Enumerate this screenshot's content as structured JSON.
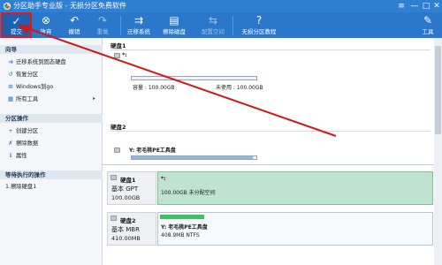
{
  "window": {
    "title": "分区助手专业版 - 无损分区免费软件",
    "controls": {
      "menu": "≡",
      "minimize": "—",
      "maximize": "□",
      "close": "✕"
    }
  },
  "toolbar": {
    "buttons": [
      {
        "label": "提交",
        "icon": "check-icon",
        "glyph": "✓"
      },
      {
        "label": "放弃",
        "icon": "cancel-icon",
        "glyph": "⊗"
      },
      {
        "label": "撤销",
        "icon": "undo-icon",
        "glyph": "↶"
      },
      {
        "label": "重做",
        "icon": "redo-icon",
        "glyph": "↷"
      },
      {
        "label": "迁移系统",
        "icon": "migrate-os-icon",
        "glyph": "⇉"
      },
      {
        "label": "擦除磁盘",
        "icon": "wipe-disk-icon",
        "glyph": "▤"
      },
      {
        "label": "配置空间",
        "icon": "allocate-space-icon",
        "glyph": "⇆"
      },
      {
        "label": "无损分区教程",
        "icon": "tutorial-icon",
        "glyph": "?"
      },
      {
        "label": "工具",
        "icon": "tools-icon",
        "glyph": "✎"
      }
    ]
  },
  "left_panel": {
    "sections": [
      {
        "title": "向导",
        "items": [
          {
            "label": "迁移系统到固态硬盘",
            "icon": "ssd-migrate-icon",
            "glyph": "⇉"
          },
          {
            "label": "恢复分区",
            "icon": "recover-partition-icon",
            "glyph": "↺"
          },
          {
            "label": "Windows到go",
            "icon": "windows-to-go-icon",
            "glyph": "⊞"
          },
          {
            "label": "所有工具",
            "icon": "all-tools-icon",
            "glyph": "▦",
            "has_submenu": true,
            "arrow": "▸"
          }
        ]
      },
      {
        "title": "分区操作",
        "items": [
          {
            "label": "创建分区",
            "icon": "create-partition-icon",
            "glyph": "+"
          },
          {
            "label": "擦除数据",
            "icon": "wipe-data-icon",
            "glyph": "✗"
          },
          {
            "label": "属性",
            "icon": "properties-icon",
            "glyph": "ℹ"
          }
        ]
      },
      {
        "title": "等待执行的操作",
        "items": [
          {
            "label": "1.擦除硬盘1"
          }
        ]
      }
    ]
  },
  "disk_list": [
    {
      "header": "硬盘1",
      "partition_label": "*:",
      "capacity": "容量 : 100.00GB",
      "unused": "未使用 : 100.00GB"
    },
    {
      "header": "硬盘2",
      "partition_label": "Y: 老毛桃PE工具盘"
    }
  ],
  "disk_map": [
    {
      "name": "硬盘1",
      "type": "基本 GPT",
      "size": "100.00GB",
      "partition": {
        "label": "*:",
        "detail": "100.00GB 未分配空间"
      }
    },
    {
      "name": "硬盘2",
      "type": "基本 MBR",
      "size": "410.00MB",
      "partition": {
        "label": "Y: 老毛桃PE工具盘",
        "detail": "408.9MB NTFS"
      }
    }
  ],
  "colors": {
    "titlebar": "#2f7fd3",
    "toolbar": "#2a77cb",
    "highlight_border": "#e01919",
    "annotation_arrow": "#d01818",
    "selected_partition": "#bfe3cf",
    "used_fill": "#3fc25f"
  }
}
